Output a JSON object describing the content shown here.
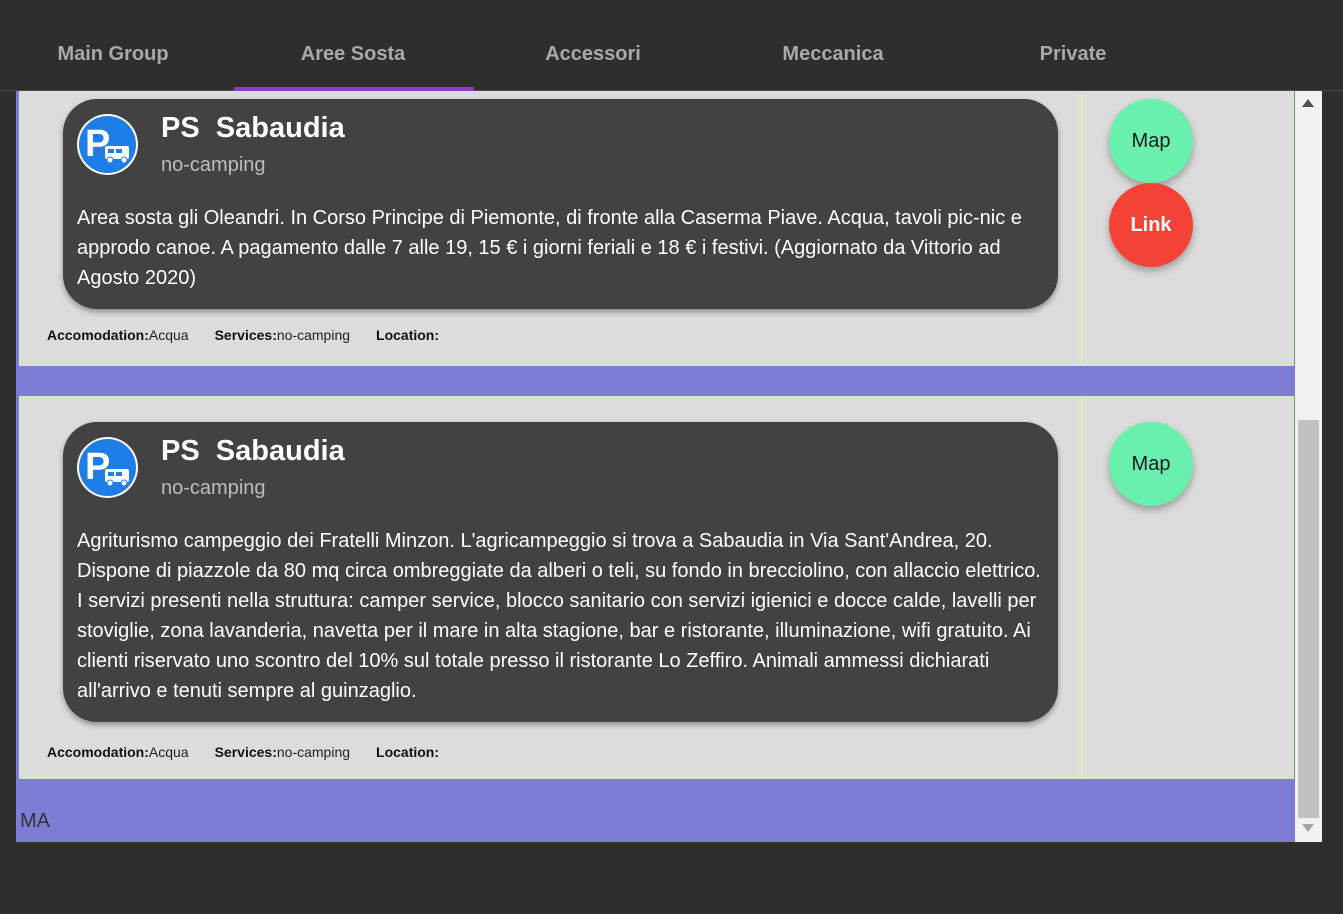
{
  "tabs": [
    {
      "label": "Main Group"
    },
    {
      "label": "Aree Sosta"
    },
    {
      "label": "Accessori"
    },
    {
      "label": "Meccanica"
    },
    {
      "label": "Private"
    }
  ],
  "active_tab": "Aree Sosta",
  "cards": [
    {
      "icon": "parking-camper-icon",
      "title": "PS  Sabaudia",
      "subtitle": "no-camping",
      "description": "Area sosta gli Oleandri. In Corso Principe di Piemonte, di fronte alla Caserma Piave. Acqua, tavoli pic-nic e approdo canoe. A pagamento dalle 7 alle 19, 15 € i giorni feriali e 18 € i festivi. (Aggiornato da Vittorio ad Agosto 2020)",
      "accomodation_label": "Accomodation:",
      "accomodation_value": "Acqua",
      "services_label": "Services:",
      "services_value": "no-camping",
      "location_label": "Location:",
      "location_value": "",
      "map_label": "Map",
      "link_label": "Link"
    },
    {
      "icon": "parking-camper-icon",
      "title": "PS  Sabaudia",
      "subtitle": "no-camping",
      "description": "Agriturismo campeggio dei Fratelli Minzon. L'agricampeggio si trova a Sabaudia in Via Sant'Andrea, 20. Dispone di piazzole da 80 mq circa ombreggiate da alberi o teli, su fondo in brecciolino, con allaccio elettrico. I servizi presenti nella struttura: camper service, blocco sanitario con servizi igienici e docce calde, lavelli per stoviglie, zona lavanderia, navetta per il mare in alta stagione, bar e ristorante, illuminazione, wifi gratuito. Ai clienti riservato uno scontro del 10% sul totale presso il ristorante Lo Zeffiro. Animali ammessi dichiarati all'arrivo e tenuti sempre al guinzaglio.",
      "accomodation_label": "Accomodation:",
      "accomodation_value": "Acqua",
      "services_label": "Services:",
      "services_value": "no-camping",
      "location_label": "Location:",
      "location_value": "",
      "map_label": "Map"
    }
  ],
  "footer_text": "MA",
  "colors": {
    "background": "#2f2d2e",
    "tab_indicator": "#8e3bc5",
    "panel": "#7e7dd6",
    "card": "#dcdcdc",
    "bubble": "#424242",
    "map_button": "#69f0ae",
    "link_button": "#f44336"
  }
}
